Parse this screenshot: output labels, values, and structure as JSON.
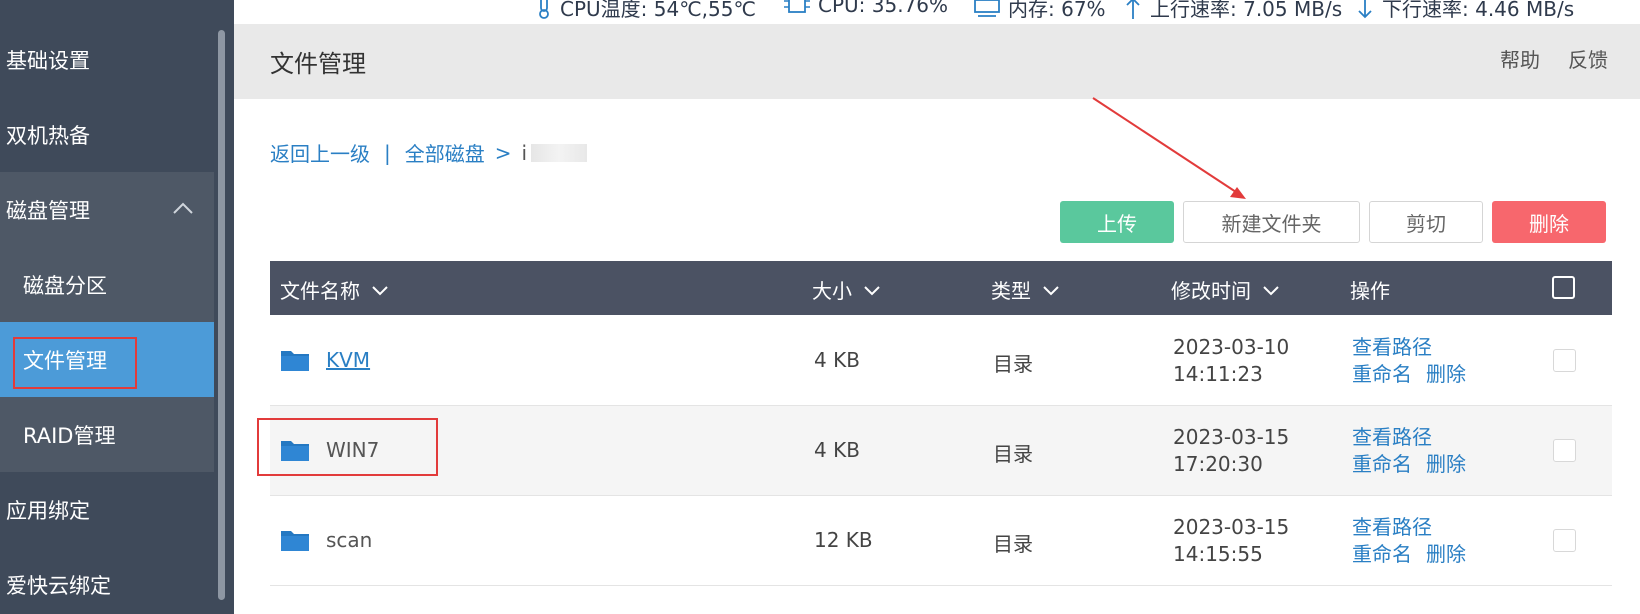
{
  "status": {
    "temp": "CPU温度: 54℃,55℃",
    "cpu": "CPU: 35.76%",
    "mem": "内存: 67%",
    "up": "上行速率: 7.05 MB/s",
    "down": "下行速率: 4.46 MB/s"
  },
  "sidebar": {
    "items": [
      {
        "label": "基础设置"
      },
      {
        "label": "双机热备"
      },
      {
        "label": "磁盘管理"
      },
      {
        "label": "磁盘分区"
      },
      {
        "label": "文件管理"
      },
      {
        "label": "RAID管理"
      },
      {
        "label": "应用绑定"
      },
      {
        "label": "爱快云绑定"
      }
    ]
  },
  "header": {
    "title": "文件管理",
    "help": "帮助",
    "feedback": "反馈"
  },
  "breadcrumb": {
    "back": "返回上一级",
    "divider": "|",
    "all_disks": "全部磁盘",
    "arrow": ">",
    "current": "i"
  },
  "toolbar": {
    "upload": "上传",
    "new_folder": "新建文件夹",
    "cut": "剪切",
    "delete": "删除"
  },
  "table": {
    "columns": {
      "name": "文件名称",
      "size": "大小",
      "type": "类型",
      "mtime": "修改时间",
      "ops": "操作"
    },
    "rows": [
      {
        "name": "KVM",
        "size": "4 KB",
        "type": "目录",
        "date": "2023-03-10",
        "time": "14:11:23"
      },
      {
        "name": "WIN7",
        "size": "4 KB",
        "type": "目录",
        "date": "2023-03-15",
        "time": "17:20:30"
      },
      {
        "name": "scan",
        "size": "12 KB",
        "type": "目录",
        "date": "2023-03-15",
        "time": "14:15:55"
      }
    ],
    "op_view_path": "查看路径",
    "op_rename": "重命名",
    "op_delete": "删除"
  },
  "colors": {
    "sidebar_bg": "#3f4a5a",
    "active": "#4c9bd8",
    "upload": "#5ac89d",
    "delete": "#f7676d",
    "link": "#2a7fc4",
    "table_head": "#4b5263",
    "annotation": "#e23b3b"
  }
}
